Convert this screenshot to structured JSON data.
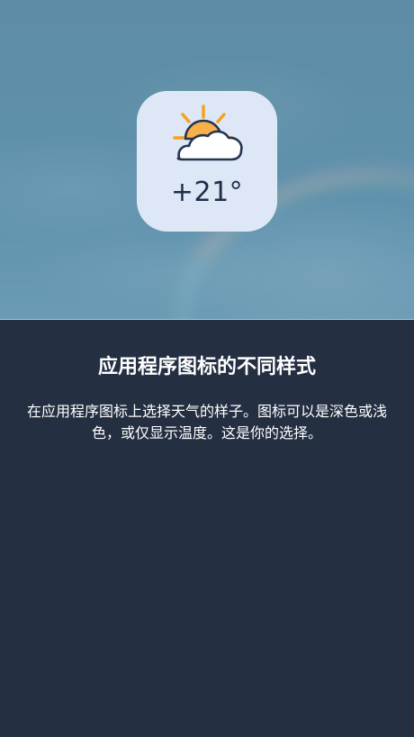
{
  "icon_preview": {
    "temperature": "+21°",
    "icon_name": "partly-cloudy-sun-icon",
    "colors": {
      "sun": "#f7b14b",
      "sun_rays": "#f6a21a",
      "cloud_fill": "#ffffff",
      "cloud_stroke": "#253551",
      "icon_background": "#dde7f5"
    }
  },
  "info": {
    "title": "应用程序图标的不同样式",
    "description": "在应用程序图标上选择天气的样子。图标可以是深色或浅色，或仅显示温度。这是你的选择。"
  }
}
